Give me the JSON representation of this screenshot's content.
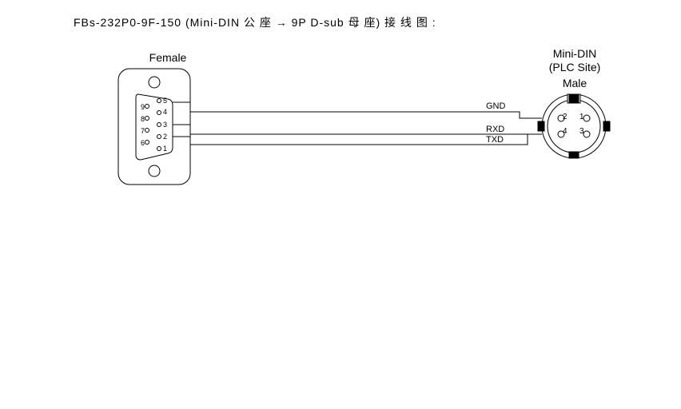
{
  "title": "FBs-232P0-9F-150 (Mini-DIN 公 座 → 9P D-sub 母 座)   接 线 图 :",
  "left_connector": {
    "label": "Female",
    "type": "9P D-sub",
    "pin_labels": {
      "1": "1",
      "2": "2",
      "3": "3",
      "4": "4",
      "5": "5",
      "6": "6",
      "7": "7",
      "8": "8",
      "9": "9"
    }
  },
  "right_connector": {
    "label_line1": "Mini-DIN",
    "label_line2": "(PLC Site)",
    "label_line3": "Male",
    "pin_labels": {
      "1": "1",
      "2": "2",
      "3": "3",
      "4": "4"
    }
  },
  "signals": {
    "gnd": "GND",
    "rxd": "RXD",
    "txd": "TXD"
  },
  "chart_data": {
    "type": "table",
    "description": "Cable wiring between 9-pin D-sub (Female) and 4-pin Mini-DIN (Male, PLC site)",
    "wires": [
      {
        "dsub_pin": 5,
        "signal": "GND",
        "minidin_pin": 1
      },
      {
        "dsub_pin": 3,
        "signal": "RXD",
        "minidin_pin": 4
      },
      {
        "dsub_pin": 2,
        "signal": "TXD",
        "minidin_pin": 3
      }
    ],
    "dsub_unused_pins": [
      1,
      4,
      6,
      7,
      8,
      9
    ],
    "minidin_unused_pins": [
      2
    ]
  }
}
